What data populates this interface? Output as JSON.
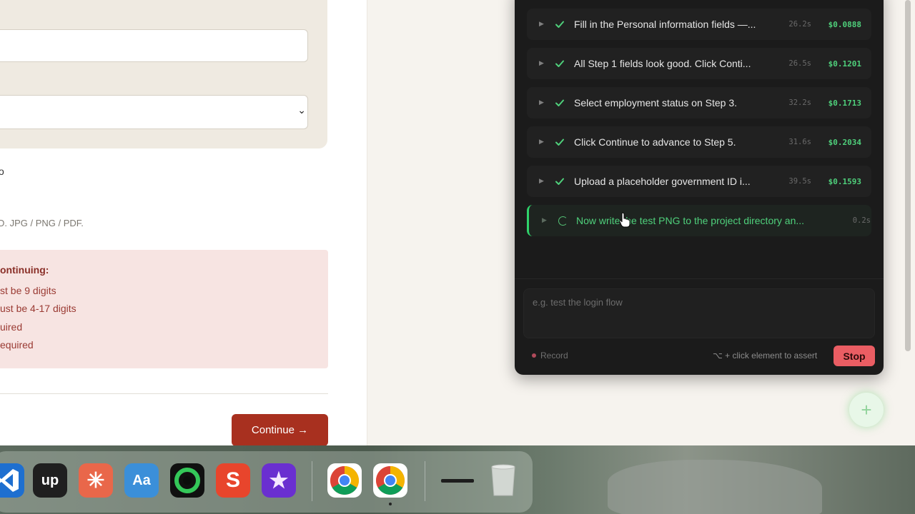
{
  "form": {
    "upload_fragment": "o",
    "upload_hint": "D. JPG / PNG / PDF.",
    "errors": {
      "title": "ontinuing:",
      "lines": [
        "st be 9 digits",
        "ust be 4-17 digits",
        "uired",
        "equired"
      ]
    },
    "continue_label": "Continue →"
  },
  "agent": {
    "steps": [
      {
        "text": "Fill in the Personal information fields —...",
        "time": "26.2s",
        "cost": "$0.0888",
        "status": "done"
      },
      {
        "text": "All Step 1 fields look good. Click Conti...",
        "time": "26.5s",
        "cost": "$0.1201",
        "status": "done"
      },
      {
        "text": "Select employment status on Step 3.",
        "time": "32.2s",
        "cost": "$0.1713",
        "status": "done"
      },
      {
        "text": "Click Continue to advance to Step 5.",
        "time": "31.6s",
        "cost": "$0.2034",
        "status": "done"
      },
      {
        "text": "Upload a placeholder government ID i...",
        "time": "39.5s",
        "cost": "$0.1593",
        "status": "done"
      },
      {
        "text": "Now write the test PNG to the project directory an...",
        "time": "0.2s",
        "cost": "",
        "status": "running"
      }
    ],
    "prompt_placeholder": "e.g. test the login flow",
    "record_label": "Record",
    "assert_hint": "⌥ + click element to assert",
    "stop_label": "Stop"
  },
  "dock": {
    "apps": [
      {
        "name": "vscode-icon",
        "label": "",
        "bg": "#1e6fd0",
        "fg": "#ffffff"
      },
      {
        "name": "upwork-icon",
        "label": "up",
        "bg": "#1f1f1f",
        "fg": "#ffffff"
      },
      {
        "name": "claude-icon",
        "label": "✳",
        "bg": "#e9674a",
        "fg": "#ffffff"
      },
      {
        "name": "dictionary-icon",
        "label": "Aa",
        "bg": "#3b8fd9",
        "fg": "#ffffff"
      },
      {
        "name": "camera-shutter-icon",
        "label": "",
        "bg": "#101010",
        "fg": "#34c759"
      },
      {
        "name": "s-app-icon",
        "label": "S",
        "bg": "#e8452c",
        "fg": "#ffffff"
      },
      {
        "name": "imovie-icon",
        "label": "★",
        "bg": "#6a2fd0",
        "fg": "#f5e8ff"
      },
      {
        "name": "chrome-icon",
        "label": "",
        "bg": "#ffffff",
        "fg": "#4285f4"
      },
      {
        "name": "chrome-icon",
        "label": "",
        "bg": "#ffffff",
        "fg": "#4285f4"
      },
      {
        "name": "minimized-window-icon",
        "label": "",
        "bg": "transparent",
        "fg": "#222"
      },
      {
        "name": "trash-icon",
        "label": "",
        "bg": "transparent",
        "fg": "#cfd3cf"
      }
    ]
  }
}
